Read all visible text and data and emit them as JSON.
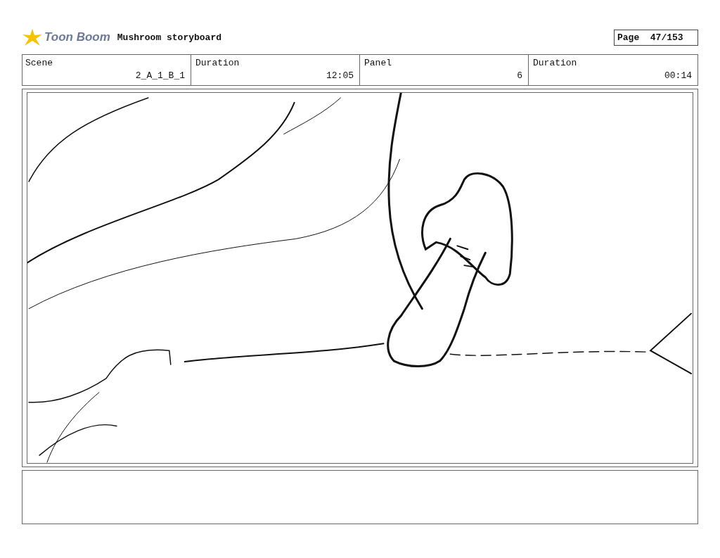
{
  "header": {
    "logo_text": "Toon Boom",
    "title": "Mushroom storyboard",
    "page": "Page  47/153"
  },
  "info": [
    {
      "label": "Scene",
      "value": "2_A_1_B_1"
    },
    {
      "label": "Duration",
      "value": "12:05"
    },
    {
      "label": "Panel",
      "value": "6"
    },
    {
      "label": "Duration",
      "value": "00:14"
    }
  ]
}
